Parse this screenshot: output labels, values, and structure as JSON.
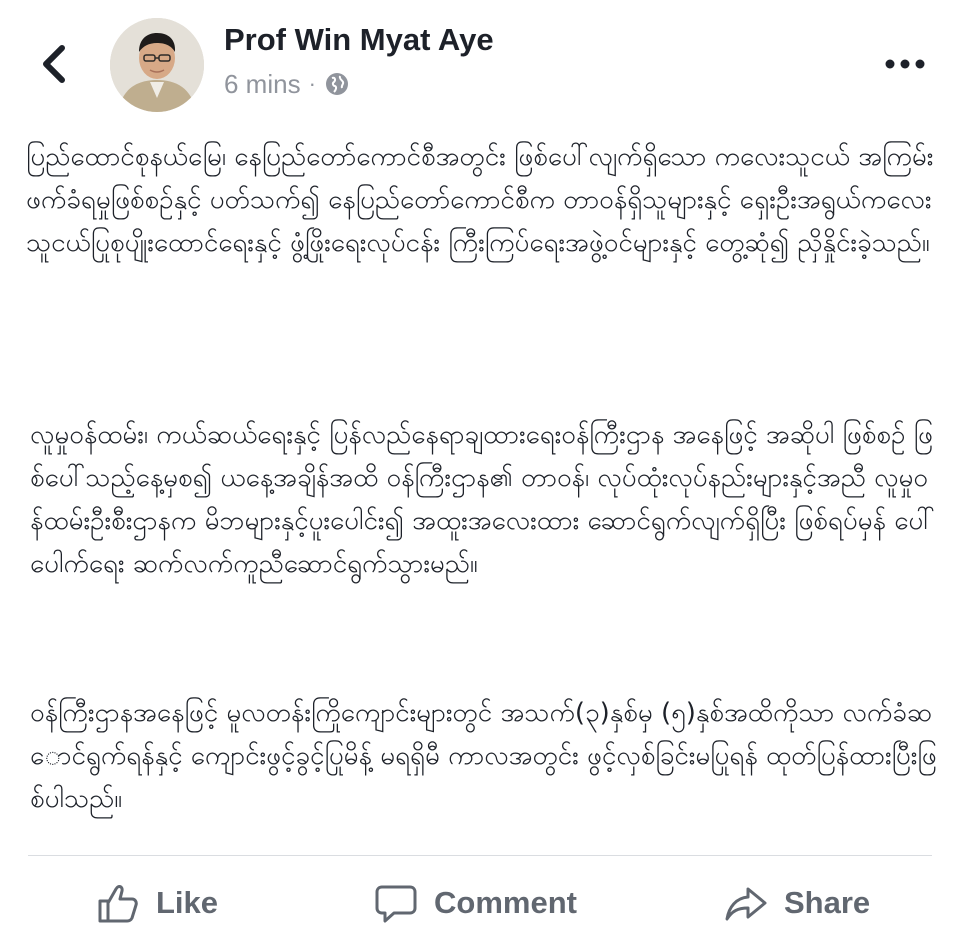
{
  "post": {
    "author": "Prof Win Myat Aye",
    "time": "6 mins",
    "separator": "·",
    "privacy_icon": "globe-icon",
    "paragraphs": [
      "ပြည်ထောင်စုနယ်မြေ၊ နေပြည်တော်ကောင်စီအတွင်း ဖြစ်ပေါ်လျက်ရှိသော ကလေးသူငယ် အကြမ်းဖက်ခံရမှုဖြစ်စဉ်နှင့် ပတ်သက်၍ နေပြည်တော်ကောင်စီက တာဝန်ရှိသူများနှင့် ရှေးဦးအရွယ်ကလေးသူငယ်ပြုစုပျိုးထောင်ရေးနှင့် ဖွံ့ဖြိုးရေးလုပ်ငန်း ကြီးကြပ်ရေးအဖွဲ့ဝင်များနှင့် တွေ့ဆုံ၍ ညှိနှိုင်းခဲ့သည်။",
      "လူမှုဝန်ထမ်း၊ ကယ်ဆယ်ရေးနှင့် ပြန်လည်နေရာချထားရေးဝန်ကြီးဌာန အနေဖြင့် အဆိုပါ ဖြစ်စဉ် ဖြစ်ပေါ်သည့်နေ့မှစ၍ ယနေ့အချိန်အထိ ဝန်ကြီးဌာန၏ တာဝန်၊ လုပ်ထုံးလုပ်နည်းများနှင့်အညီ လူမှုဝန်ထမ်းဦးစီးဌာနက မိဘများနှင့်ပူးပေါင်း၍ အထူးအလေးထား ဆောင်ရွက်လျက်ရှိပြီး ဖြစ်ရပ်မှန် ပေါ်ပေါက်ရေး ဆက်လက်ကူညီဆောင်ရွက်သွားမည်။",
      "ဝန်ကြီးဌာနအနေဖြင့် မူလတန်းကြိုကျောင်းများတွင် အသက်(၃)နှစ်မှ (၅)နှစ်အထိကိုသာ လက်ခံဆောင်ရွက်ရန်နှင့် ကျောင်းဖွင့်ခွင့်ပြုမိန့် မရရှိမီ ကာလအတွင်း ဖွင့်လှစ်ခြင်းမပြုရန် ထုတ်ပြန်ထားပြီးဖြစ်ပါသည်။"
    ]
  },
  "header": {
    "back_icon": "chevron-left-icon",
    "more_icon": "more-dots-icon"
  },
  "actions": {
    "like_label": "Like",
    "comment_label": "Comment",
    "share_label": "Share"
  },
  "colors": {
    "text": "#1d2129",
    "meta": "#90949c",
    "action": "#616770",
    "divider": "#dadde1"
  }
}
